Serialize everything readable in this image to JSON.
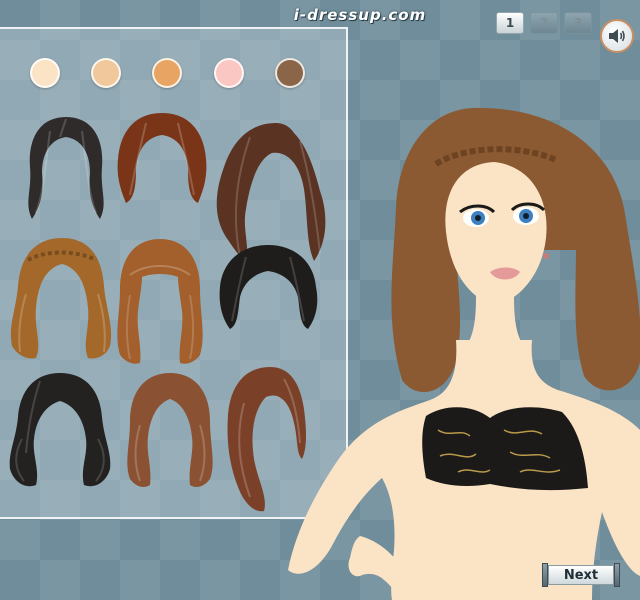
{
  "header": {
    "site_logo": "i-dressup.com"
  },
  "pager": {
    "pages": [
      {
        "label": "1",
        "active": true
      },
      {
        "label": "2",
        "active": false
      },
      {
        "label": "3",
        "active": false
      }
    ]
  },
  "icons": {
    "sound": "speaker-icon"
  },
  "skin_swatches": [
    "#fbe3c5",
    "#f1c79c",
    "#e7a462",
    "#fbc7c3",
    "#8a6547"
  ],
  "hair_styles": [
    {
      "name": "long-wavy-black",
      "color": "#2f2b2a"
    },
    {
      "name": "bob-auburn",
      "color": "#7a3518"
    },
    {
      "name": "long-curly-dark-brown",
      "color": "#5a3322"
    },
    {
      "name": "braided-wavy-light-brown",
      "color": "#a4692a"
    },
    {
      "name": "bangs-wavy-brown",
      "color": "#a35f2c"
    },
    {
      "name": "short-black",
      "color": "#1f1c1c"
    },
    {
      "name": "curly-black",
      "color": "#242121"
    },
    {
      "name": "wavy-medium-brown",
      "color": "#8a5233"
    },
    {
      "name": "side-swept-auburn",
      "color": "#7b4128"
    }
  ],
  "model": {
    "hair_color": "#8b5a32",
    "skin_color": "#fbe3c5",
    "eye_color": "#3d7fbf",
    "top": {
      "kind": "strapless-bandeau",
      "color": "#1c1a18",
      "pattern_color": "#b89a4a"
    }
  },
  "footer": {
    "next_label": "Next"
  }
}
